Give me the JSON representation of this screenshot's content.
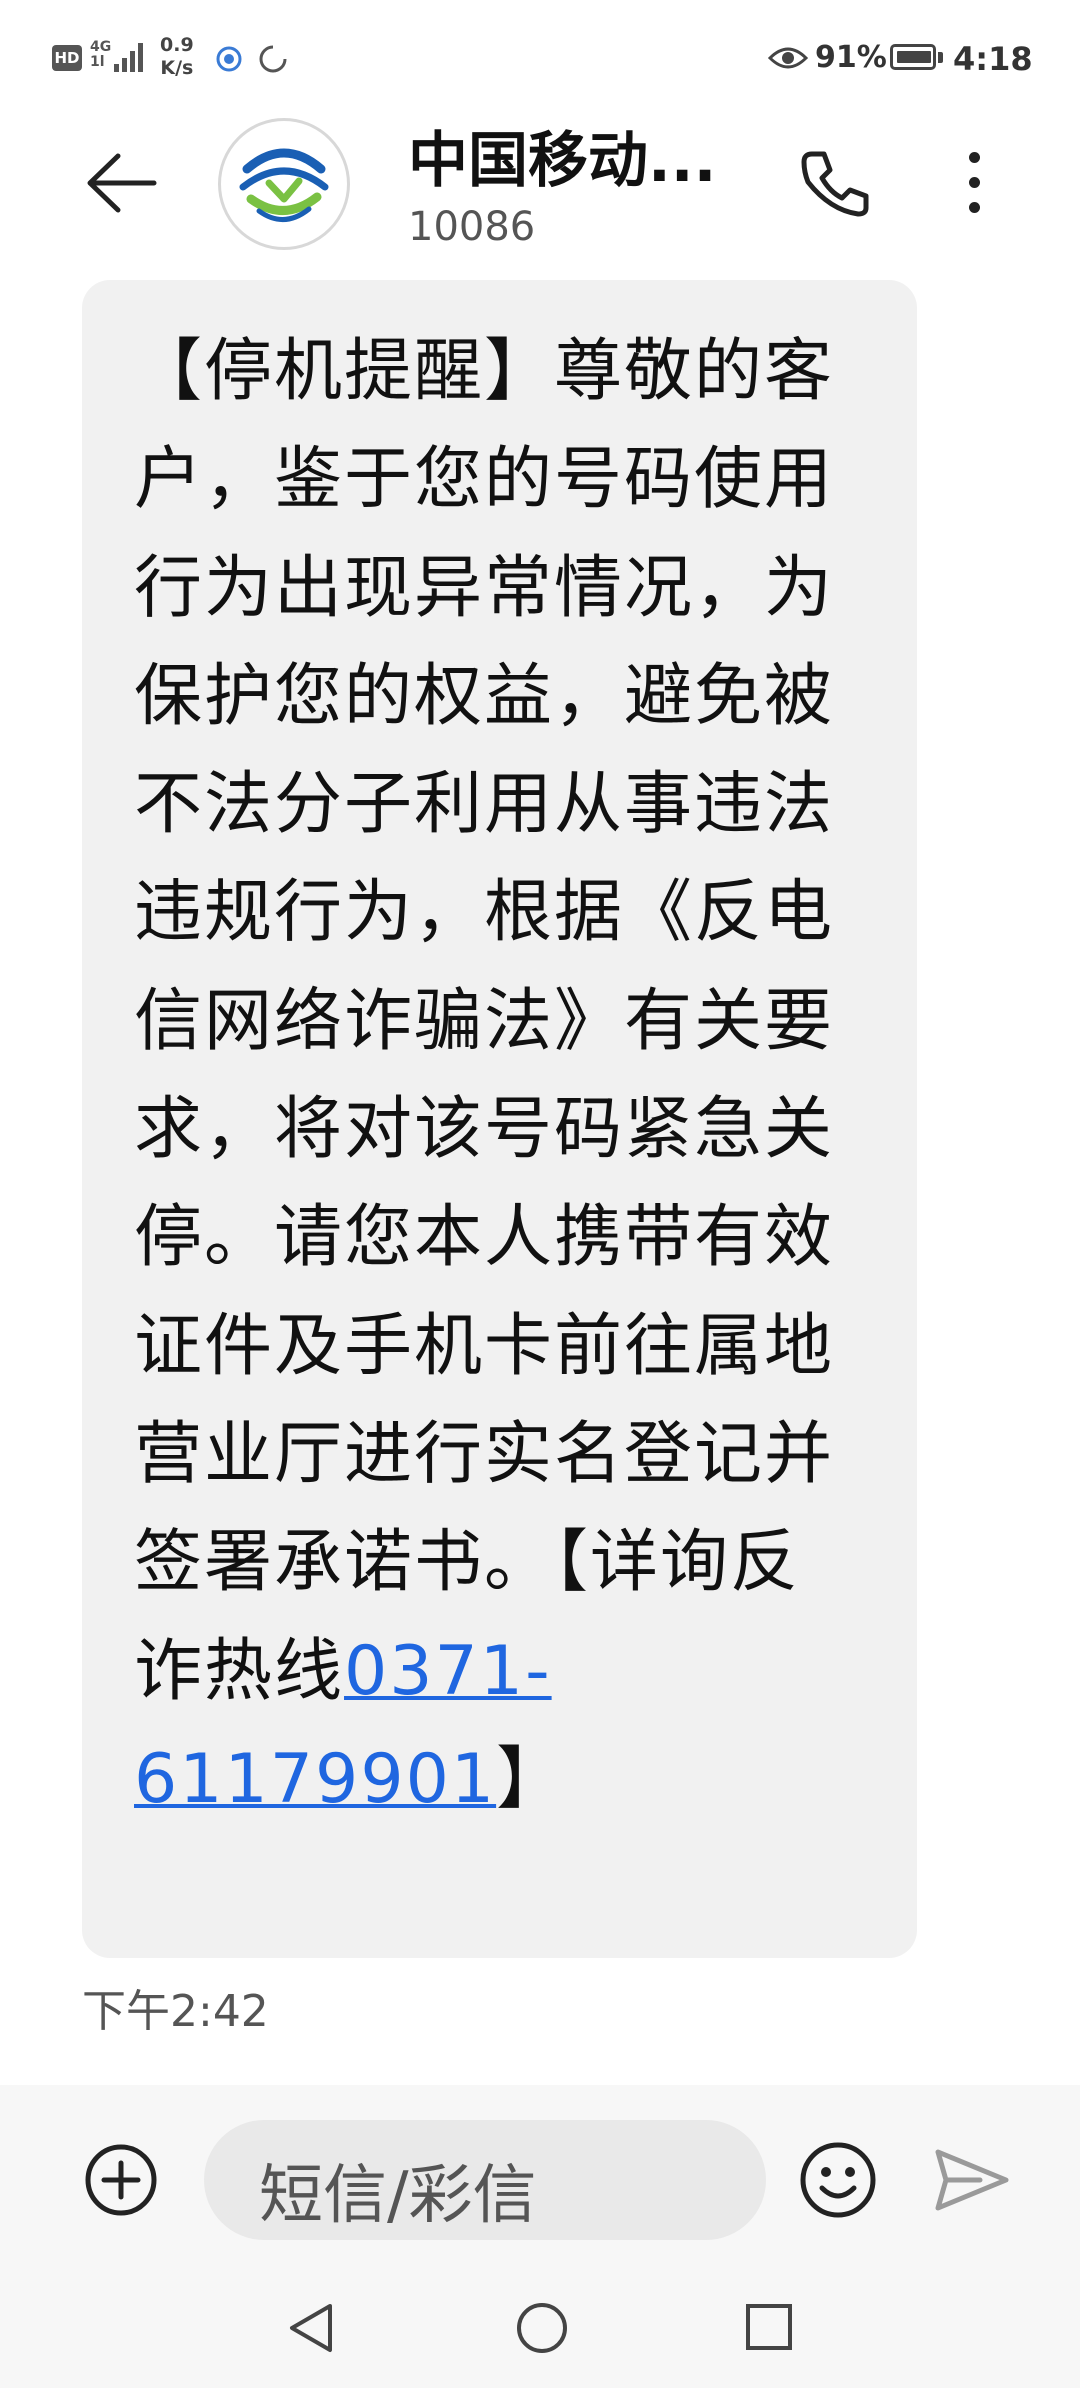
{
  "status_bar": {
    "hd": "HD",
    "network_type": "4G",
    "network_sub": "1l",
    "speed_value": "0.9",
    "speed_unit": "K/s",
    "battery_percent": "91%",
    "time": "4:18"
  },
  "header": {
    "contact_name": "中国移动...",
    "contact_number": "10086"
  },
  "message": {
    "body": "【停机提醒】尊敬的客户，鉴于您的号码使用行为出现异常情况，为保护您的权益，避免被不法分子利用从事违法违规行为，根据《反电信网络诈骗法》有关要求，将对该号码紧急关停。请您本人携带有效证件及手机卡前往属地营业厅进行实名登记并签署承诺书。【详询反诈热线",
    "phone_link": "0371-61179901",
    "body_end": "】",
    "timestamp": "下午2:42"
  },
  "composer": {
    "placeholder": "短信/彩信"
  },
  "icons": {
    "back": "arrow-left-icon",
    "call": "phone-icon",
    "more": "more-vertical-icon",
    "add": "plus-circle-icon",
    "emoji": "emoji-icon",
    "send": "send-icon"
  },
  "colors": {
    "link": "#1f66e0",
    "bubble": "#f1f1f1",
    "logo_blue": "#1a5fb4",
    "logo_green": "#7ac143"
  }
}
